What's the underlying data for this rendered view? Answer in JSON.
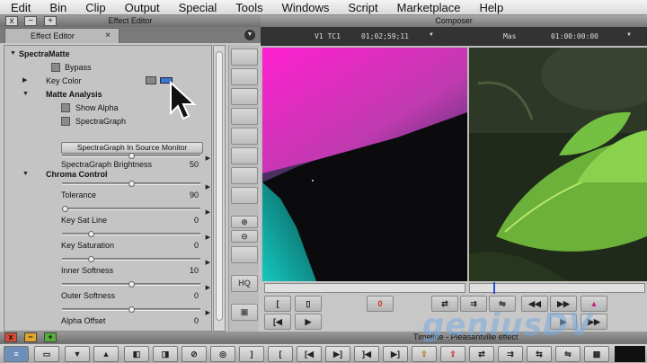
{
  "menubar": {
    "items": [
      "Edit",
      "Bin",
      "Clip",
      "Output",
      "Special",
      "Tools",
      "Windows",
      "Script",
      "Marketplace",
      "Help"
    ]
  },
  "effect_editor": {
    "window_title": "Effect Editor",
    "close_btn": "x",
    "min_btn": "−",
    "add_btn": "+",
    "tab_label": "Effect Editor",
    "tab_close": "×",
    "tree": [
      {
        "label": "SpectraMatte",
        "expanded": true
      },
      {
        "label": "Bypass",
        "checkbox": true
      },
      {
        "label": "Key Color",
        "expanded": false
      },
      {
        "label": "Matte Analysis",
        "expanded": true
      },
      {
        "label": "Show Alpha",
        "checkbox": true
      },
      {
        "label": "SpectraGraph",
        "checkbox": true
      },
      {
        "label": "SpectraGraph In Source Monitor",
        "button": true
      },
      {
        "label": "SpectraGraph Brightness",
        "value": "50",
        "level": 0.5
      },
      {
        "label": "Chroma Control",
        "expanded": true
      },
      {
        "label": "Tolerance",
        "value": "90",
        "level": 0.5
      },
      {
        "label": "Key Sat Line",
        "value": "0",
        "level": 0.0
      },
      {
        "label": "Key Saturation",
        "value": "0",
        "level": 0.2
      },
      {
        "label": "Inner Softness",
        "value": "10",
        "level": 0.2
      },
      {
        "label": "Outer Softness",
        "value": "0",
        "level": 0.5
      },
      {
        "label": "Alpha Offset",
        "value": "0",
        "level": 0.5
      }
    ],
    "strip": {
      "hq_label": "HQ"
    }
  },
  "composer": {
    "title": "Composer",
    "left_track": "V1 TC1",
    "left_timecode": "01;02;59;11",
    "right_track": "Mas",
    "right_timecode": "01:00:00:00"
  },
  "timeline": {
    "title": "Timeline - Pleasantville effect",
    "close_btn": "x",
    "min_btn": "−",
    "add_btn": "+"
  },
  "watermark": "geniusDV",
  "colors": {
    "close_red": "#d94a3a",
    "min_yellow": "#e0a52a",
    "add_green": "#56b13a",
    "magenta": "#ff1fd0",
    "cyan": "#15c9c0"
  }
}
